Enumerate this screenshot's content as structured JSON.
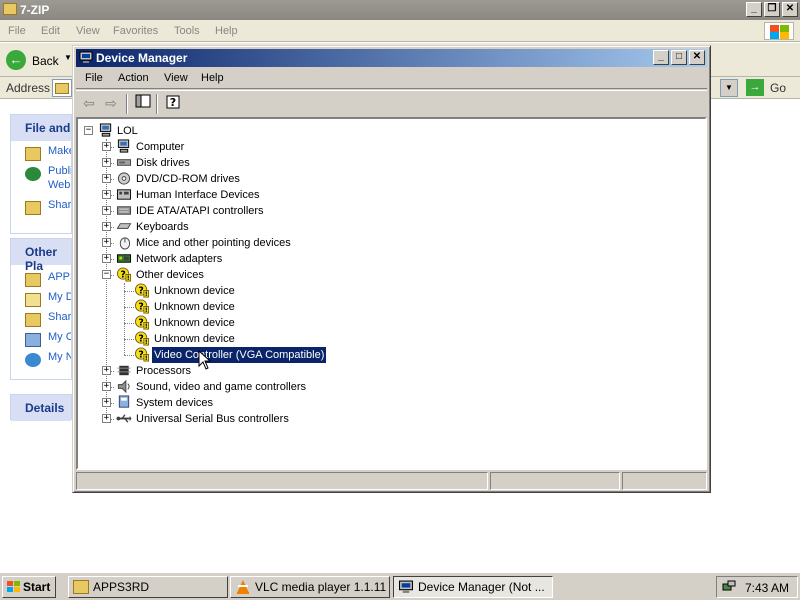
{
  "explorer": {
    "title": "7-ZIP",
    "menu": [
      "File",
      "Edit",
      "View",
      "Favorites",
      "Tools",
      "Help"
    ],
    "back_label": "Back",
    "address_label": "Address",
    "go_label": "Go",
    "panels": {
      "file_tasks": {
        "header": "File and",
        "items": [
          "Make",
          "Publis",
          "Web",
          "Share"
        ]
      },
      "other_places": {
        "header": "Other Pla",
        "items": [
          "APPS",
          "My D",
          "Share",
          "My C",
          "My N"
        ]
      },
      "details": {
        "header": "Details"
      }
    }
  },
  "device_manager": {
    "title": "Device Manager",
    "menu": [
      "File",
      "Action",
      "View",
      "Help"
    ],
    "root": "LOL",
    "categories": [
      {
        "label": "Computer",
        "icon": "computer-icon",
        "expanded": false
      },
      {
        "label": "Disk drives",
        "icon": "disk-drive-icon",
        "expanded": false
      },
      {
        "label": "DVD/CD-ROM drives",
        "icon": "cdrom-icon",
        "expanded": false
      },
      {
        "label": "Human Interface Devices",
        "icon": "hid-icon",
        "expanded": false
      },
      {
        "label": "IDE ATA/ATAPI controllers",
        "icon": "ide-controller-icon",
        "expanded": false
      },
      {
        "label": "Keyboards",
        "icon": "keyboard-icon",
        "expanded": false
      },
      {
        "label": "Mice and other pointing devices",
        "icon": "mouse-icon",
        "expanded": false
      },
      {
        "label": "Network adapters",
        "icon": "network-adapter-icon",
        "expanded": false
      },
      {
        "label": "Other devices",
        "icon": "unknown-device-icon",
        "expanded": true
      },
      {
        "label": "Processors",
        "icon": "processor-icon",
        "expanded": false
      },
      {
        "label": "Sound, video and game controllers",
        "icon": "sound-icon",
        "expanded": false
      },
      {
        "label": "System devices",
        "icon": "system-device-icon",
        "expanded": false
      },
      {
        "label": "Universal Serial Bus controllers",
        "icon": "usb-icon",
        "expanded": false
      }
    ],
    "other_devices": [
      {
        "label": "Unknown device",
        "selected": false
      },
      {
        "label": "Unknown device",
        "selected": false
      },
      {
        "label": "Unknown device",
        "selected": false
      },
      {
        "label": "Unknown device",
        "selected": false
      },
      {
        "label": "Video Controller (VGA Compatible)",
        "selected": true
      }
    ]
  },
  "taskbar": {
    "start_label": "Start",
    "buttons": [
      {
        "label": "APPS3RD",
        "icon": "folder-icon",
        "active": false
      },
      {
        "label": "VLC media player 1.1.11 ...",
        "icon": "vlc-icon",
        "active": false
      },
      {
        "label": "Device Manager (Not ...",
        "icon": "device-manager-icon",
        "active": true
      }
    ],
    "clock": "7:43 AM"
  },
  "colors": {
    "title_active": "#0a246a",
    "title_gradient_end": "#a6caf0",
    "selection": "#0a246a",
    "face": "#d4d0c8",
    "xp_blue": "#215dc6"
  }
}
